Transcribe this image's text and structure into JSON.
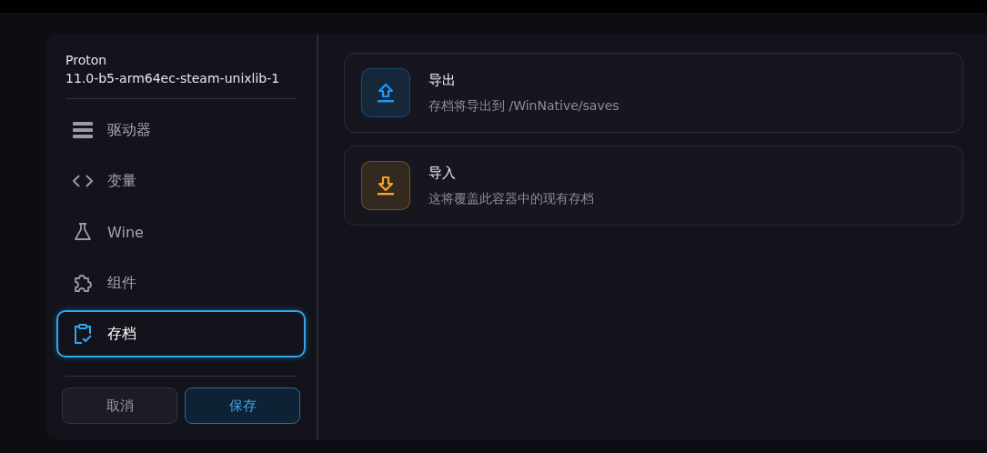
{
  "container": {
    "runner": "Proton",
    "version": "11.0-b5-arm64ec-steam-unixlib-1"
  },
  "sidebar": {
    "items": [
      {
        "label": "驱动器",
        "selected": false
      },
      {
        "label": "变量",
        "selected": false
      },
      {
        "label": "Wine",
        "selected": false
      },
      {
        "label": "组件",
        "selected": false
      },
      {
        "label": "存档",
        "selected": true
      }
    ]
  },
  "buttons": [
    {
      "label": "取消",
      "kind": "secondary"
    },
    {
      "label": "保存",
      "kind": "primary"
    }
  ],
  "actions": [
    {
      "kind": "export",
      "title": "导出",
      "description": "存档将导出到 /WinNative/saves",
      "color": "#2196f3"
    },
    {
      "kind": "import",
      "title": "导入",
      "description": "这将覆盖此容器中的现有存档",
      "color": "#f5a623"
    }
  ]
}
